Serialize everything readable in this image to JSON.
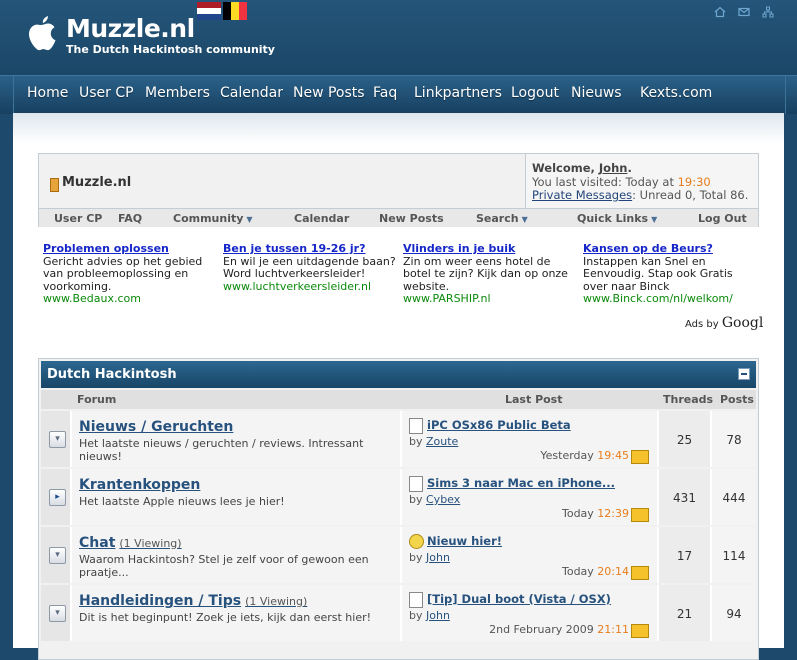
{
  "header": {
    "site_name": "Muzzle.nl",
    "tagline": "The Dutch Hackintosh community",
    "flags": [
      "netherlands-flag",
      "belgium-flag"
    ],
    "top_icons": [
      "home-icon",
      "mail-icon",
      "sitemap-icon"
    ]
  },
  "nav": {
    "items": [
      "Home",
      "User CP",
      "Members",
      "Calendar",
      "New Posts",
      "Faq",
      "Linkpartners",
      "Logout",
      "Nieuws",
      "Kexts.com"
    ]
  },
  "welcome": {
    "site_title": "Muzzle.nl",
    "greeting_prefix": "Welcome, ",
    "username": "John",
    "greeting_suffix": ".",
    "last_visited_prefix": "You last visited: Today at ",
    "last_visited_time": "19:30",
    "pm_link": "Private Messages",
    "pm_status": ": Unread 0, Total 86."
  },
  "quickbar": {
    "items": [
      "User CP",
      "FAQ",
      "Community",
      "Calendar",
      "New Posts",
      "Search",
      "Quick Links",
      "Log Out"
    ]
  },
  "ads": {
    "items": [
      {
        "title": "Problemen oplossen",
        "text": "Gericht advies op het gebied van probleemoplossing en voorkoming.",
        "url": "www.Bedaux.com"
      },
      {
        "title": "Ben je tussen 19-26 jr?",
        "text": "En wil je een uitdagende baan? Word luchtverkeersleider!",
        "url": "www.luchtverkeersleider.nl"
      },
      {
        "title": "Vlinders in je buik",
        "text": "Zin om weer eens hotel de botel te zijn? Kijk dan op onze website.",
        "url": "www.PARSHIP.nl"
      },
      {
        "title": "Kansen op de Beurs?",
        "text": "Instappen kan Snel en Eenvoudig. Stap ook Gratis over naar Binck",
        "url": "www.Binck.com/nl/welkom/"
      }
    ],
    "ads_by": "Ads by",
    "ads_brand": "Googl"
  },
  "forum": {
    "category_title": "Dutch Hackintosh",
    "columns": {
      "forum": "Forum",
      "last_post": "Last Post",
      "threads": "Threads",
      "posts": "Posts"
    },
    "rows": [
      {
        "title": "Nieuws / Geruchten",
        "viewing": "",
        "desc": "Het laatste nieuws / geruchten / reviews. Intressant nieuws!",
        "status": "old",
        "lp_icon": "document-icon",
        "lp_title": "iPC OSx86 Public Beta",
        "lp_by": "by ",
        "lp_user": "Zoute",
        "lp_date": "Yesterday ",
        "lp_time": "19:45",
        "threads": "25",
        "posts": "78"
      },
      {
        "title": "Krantenkoppen",
        "viewing": "",
        "desc": "Het laatste Apple nieuws lees je hier!",
        "status": "new",
        "lp_icon": "document-icon",
        "lp_title": "Sims 3 naar Mac en iPhone...",
        "lp_by": "by ",
        "lp_user": "Cybex",
        "lp_date": "Today ",
        "lp_time": "12:39",
        "threads": "431",
        "posts": "444"
      },
      {
        "title": "Chat",
        "viewing": "(1 Viewing)",
        "desc": "Waarom Hackintosh? Stel je zelf voor of gewoon een praatje...",
        "status": "old",
        "lp_icon": "smiley-icon",
        "lp_title": "Nieuw hier!",
        "lp_by": "by ",
        "lp_user": "John",
        "lp_date": "Today ",
        "lp_time": "20:14",
        "threads": "17",
        "posts": "114"
      },
      {
        "title": "Handleidingen / Tips",
        "viewing": "(1 Viewing)",
        "desc": "Dit is het beginpunt! Zoek je iets, kijk dan eerst hier!",
        "status": "old",
        "lp_icon": "document-icon",
        "lp_title": "[Tip] Dual boot (Vista / OSX)",
        "lp_by": "by ",
        "lp_user": "John",
        "lp_date": "2nd February 2009 ",
        "lp_time": "21:11",
        "threads": "21",
        "posts": "94"
      }
    ]
  }
}
